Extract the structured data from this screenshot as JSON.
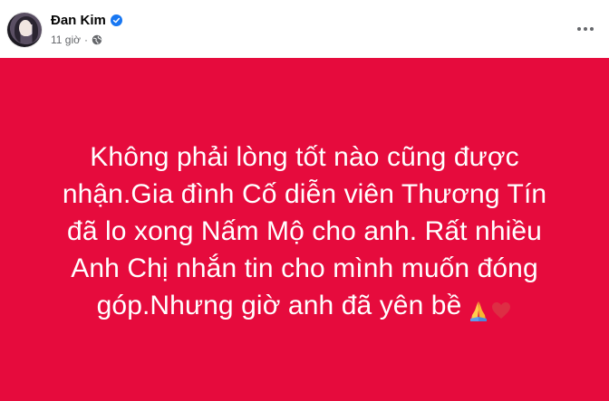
{
  "post": {
    "author": "Đan Kim",
    "time": "11 giờ",
    "separator": "·",
    "background_color": "#e60b3d",
    "text": "Không phải lòng tốt nào cũng được nhận.Gia đình Cố diễn viên Thương Tín đã lo xong Nấm Mộ cho anh. Rất nhiều Anh Chị nhắn tin cho mình muốn đóng góp.Nhưng giờ anh đã yên bề",
    "emojis": [
      "folded-hands-emoji",
      "red-heart-emoji"
    ]
  },
  "icons": {
    "verified": "verified-badge-icon",
    "audience": "globe-icon",
    "more": "more-options-icon"
  },
  "colors": {
    "verified_blue": "#1877f2",
    "meta_gray": "#65676b",
    "text_white": "#ffffff"
  }
}
